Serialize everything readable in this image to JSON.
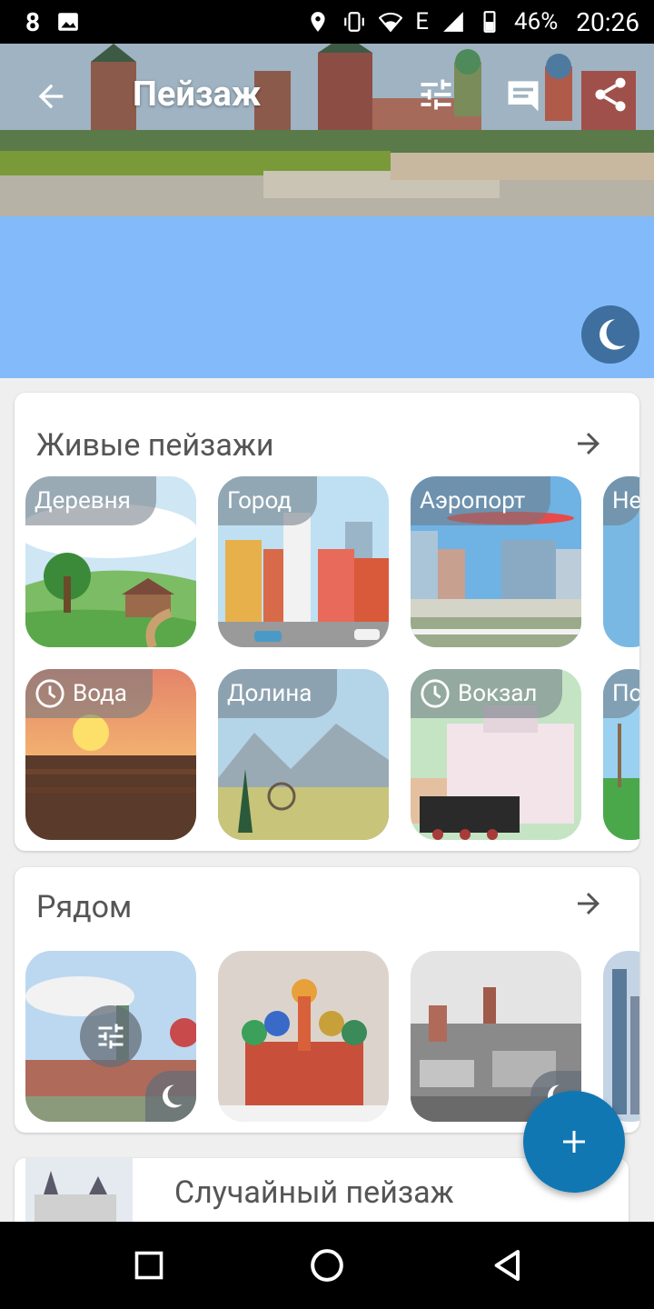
{
  "status": {
    "notification_count": "8",
    "battery": "46%",
    "time": "20:26"
  },
  "toolbar": {
    "title": "Пейзаж"
  },
  "live": {
    "title": "Живые пейзажи",
    "tiles": [
      {
        "label": "Деревня"
      },
      {
        "label": "Город"
      },
      {
        "label": "Аэропорт"
      },
      {
        "label": "Не"
      },
      {
        "label": "Вода"
      },
      {
        "label": "Долина"
      },
      {
        "label": "Вокзал"
      },
      {
        "label": "По"
      }
    ]
  },
  "nearby": {
    "title": "Рядом"
  },
  "random": {
    "title": "Случайный пейзаж"
  },
  "colors": {
    "sky": "#83bbfa",
    "fab": "#1177b3",
    "moon_button": "#3f6f9f"
  }
}
